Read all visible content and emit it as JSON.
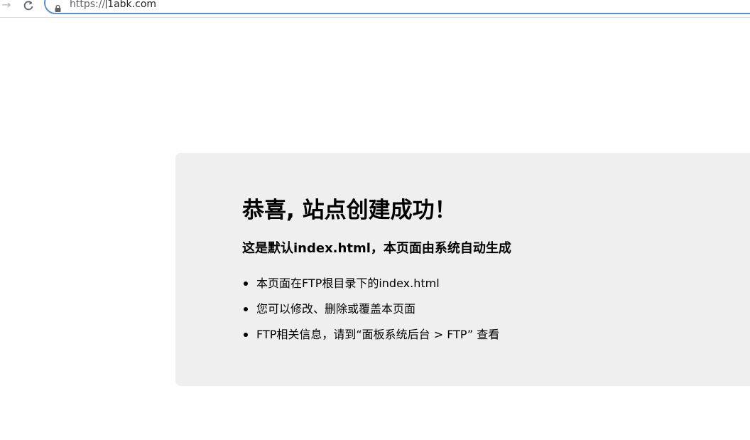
{
  "browser": {
    "url_scheme": "https://",
    "url_host": "1abk.com",
    "forward_icon": "arrow-right-icon",
    "reload_icon": "reload-icon",
    "lock_icon": "lock-icon"
  },
  "page": {
    "title": "恭喜, 站点创建成功！",
    "subtitle": "这是默认index.html，本页面由系统自动生成",
    "items": [
      "本页面在FTP根目录下的index.html",
      "您可以修改、删除或覆盖本页面",
      "FTP相关信息，请到“面板系统后台 > FTP” 查看"
    ]
  },
  "colors": {
    "panel_background": "#efefef",
    "omnibox_border": "#5b8fd8",
    "text": "#000000"
  }
}
